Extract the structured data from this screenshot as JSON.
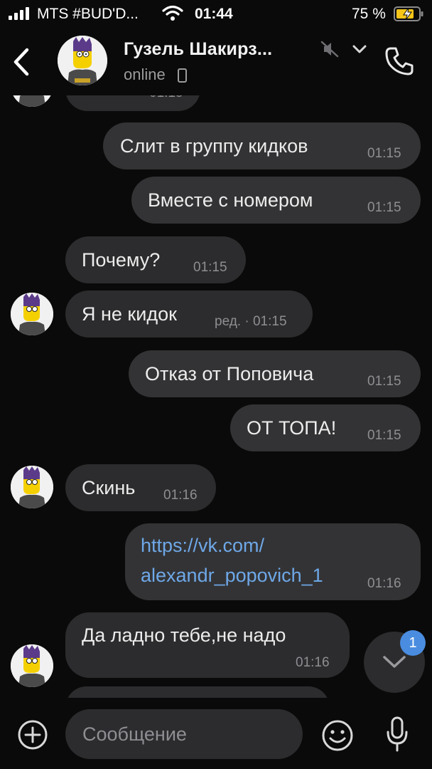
{
  "status_bar": {
    "carrier": "MTS #BUD'D...",
    "time": "01:44",
    "battery": "75 %"
  },
  "header": {
    "contact_name": "Гузель Шакирз...",
    "status": "online",
    "icons": [
      "back-chevron-icon",
      "avatar",
      "muted-icon",
      "chevron-down-icon",
      "phone-icon"
    ]
  },
  "messages": [
    {
      "dir": "in",
      "text": "Слит в группу кидков",
      "time": "01:15"
    },
    {
      "dir": "out",
      "text": "Слит в группу кидков",
      "time": "01:15"
    },
    {
      "dir": "out",
      "text": "Вместе с номером",
      "time": "01:15"
    },
    {
      "dir": "in",
      "text": "Почему?",
      "time": "01:15"
    },
    {
      "dir": "in",
      "text": "Я не кидок",
      "time": "ред. · 01:15"
    },
    {
      "dir": "out",
      "text": "Отказ от Поповича",
      "time": "01:15"
    },
    {
      "dir": "out",
      "text": "ОТ ТОПА!",
      "time": "01:15"
    },
    {
      "dir": "in",
      "text": "Скинь",
      "time": "01:16"
    },
    {
      "dir": "out",
      "link_line1": "https://vk.com/",
      "link_line2": "alexandr_popovich_1",
      "time": "01:16"
    },
    {
      "dir": "in",
      "text": "Да ладно тебе,не  надо",
      "time": "01:16"
    }
  ],
  "scroll_button": {
    "unread_count": "1"
  },
  "composer": {
    "placeholder": "Сообщение",
    "icons": [
      "add-attachment-icon",
      "emoji-icon",
      "microphone-icon"
    ]
  },
  "colors": {
    "background": "#0a0a0a",
    "bubble": "#2c2c2e",
    "link": "#6ea8e8",
    "badge": "#4a8de0"
  }
}
